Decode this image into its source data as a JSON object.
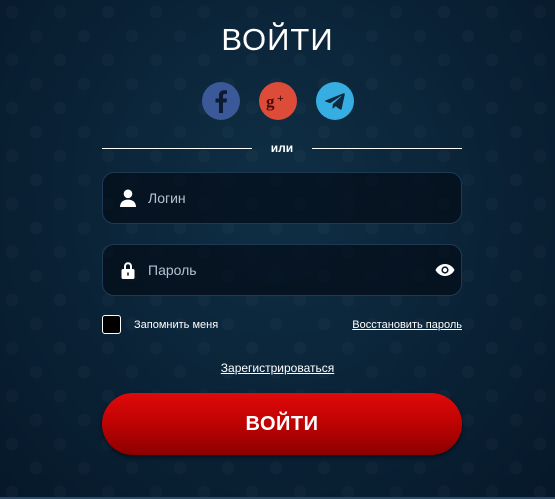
{
  "header": {
    "title": "ВОЙТИ"
  },
  "social": {
    "facebook_icon": "facebook-icon",
    "google_plus_icon": "google-plus-icon",
    "telegram_icon": "telegram-icon",
    "colors": {
      "facebook": "#3b5998",
      "google_plus": "#dd4b39",
      "telegram": "#37aee2"
    }
  },
  "divider": {
    "text": "или"
  },
  "form": {
    "login": {
      "placeholder": "Логин",
      "value": "",
      "icon": "user-icon"
    },
    "password": {
      "placeholder": "Пароль",
      "value": "",
      "icon": "lock-icon",
      "toggle_icon": "eye-icon"
    },
    "remember": {
      "label": "Запомнить меня",
      "checked": false
    },
    "restore_link": "Восстановить пароль",
    "register_link": "Зарегистрироваться",
    "submit_label": "ВОЙТИ"
  },
  "theme": {
    "background": "#0a2236",
    "accent": "#c10303"
  }
}
